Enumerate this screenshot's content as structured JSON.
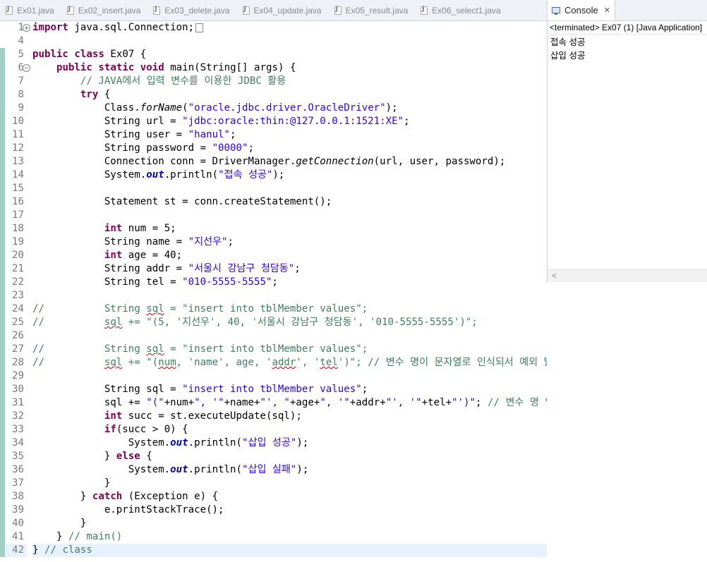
{
  "editor_tabs": [
    {
      "label": "Ex01.java"
    },
    {
      "label": "Ex02_insert.java"
    },
    {
      "label": "Ex03_delete.java"
    },
    {
      "label": "Ex04_update.java"
    },
    {
      "label": "Ex05_result.java"
    },
    {
      "label": "Ex06_select1.java"
    }
  ],
  "console": {
    "tab_label": "Console",
    "close_glyph": "✕",
    "status": "<terminated> Ex07 (1) [Java Application]",
    "output": [
      "접속 성공",
      "삽입 성공"
    ],
    "scroll_left_glyph": "<"
  },
  "code": {
    "line_numbers": [
      1,
      4,
      5,
      6,
      7,
      8,
      9,
      10,
      11,
      12,
      13,
      14,
      15,
      16,
      17,
      18,
      19,
      20,
      21,
      22,
      23,
      24,
      25,
      26,
      27,
      28,
      29,
      30,
      31,
      32,
      33,
      34,
      35,
      36,
      37,
      38,
      39,
      40,
      41,
      42
    ],
    "lines": [
      [
        {
          "t": "import",
          "c": "kw"
        },
        {
          "t": " java.sql.Connection;"
        },
        {
          "t": "",
          "c": "fbox"
        }
      ],
      [],
      [
        {
          "t": "public",
          "c": "kw"
        },
        {
          "t": " "
        },
        {
          "t": "class",
          "c": "kw"
        },
        {
          "t": " Ex07 {"
        }
      ],
      [
        {
          "t": "    "
        },
        {
          "t": "public",
          "c": "kw"
        },
        {
          "t": " "
        },
        {
          "t": "static",
          "c": "kw"
        },
        {
          "t": " "
        },
        {
          "t": "void",
          "c": "kw"
        },
        {
          "t": " main(String[] args) {"
        }
      ],
      [
        {
          "t": "        // JAVA에서 입력 변수를 이용한 JDBC 활용",
          "c": "cmt"
        }
      ],
      [
        {
          "t": "        "
        },
        {
          "t": "try",
          "c": "kw"
        },
        {
          "t": " {"
        }
      ],
      [
        {
          "t": "            Class."
        },
        {
          "t": "forName",
          "c": "sm"
        },
        {
          "t": "("
        },
        {
          "t": "\"oracle.jdbc.driver.OracleDriver\"",
          "c": "str"
        },
        {
          "t": ");"
        }
      ],
      [
        {
          "t": "            String url = "
        },
        {
          "t": "\"jdbc:oracle:thin:@127.0.0.1:1521:XE\"",
          "c": "str"
        },
        {
          "t": ";"
        }
      ],
      [
        {
          "t": "            String user = "
        },
        {
          "t": "\"hanul\"",
          "c": "str"
        },
        {
          "t": ";"
        }
      ],
      [
        {
          "t": "            String password = "
        },
        {
          "t": "\"0000\"",
          "c": "str"
        },
        {
          "t": ";"
        }
      ],
      [
        {
          "t": "            Connection conn = DriverManager."
        },
        {
          "t": "getConnection",
          "c": "sm"
        },
        {
          "t": "(url, user, password);"
        }
      ],
      [
        {
          "t": "            System."
        },
        {
          "t": "out",
          "c": "fld"
        },
        {
          "t": ".println("
        },
        {
          "t": "\"접속 성공\"",
          "c": "str"
        },
        {
          "t": ");"
        }
      ],
      [],
      [
        {
          "t": "            Statement st = conn.createStatement();"
        }
      ],
      [],
      [
        {
          "t": "            "
        },
        {
          "t": "int",
          "c": "kw"
        },
        {
          "t": " num = 5;"
        }
      ],
      [
        {
          "t": "            String name = "
        },
        {
          "t": "\"지선우\"",
          "c": "str"
        },
        {
          "t": ";"
        }
      ],
      [
        {
          "t": "            "
        },
        {
          "t": "int",
          "c": "kw"
        },
        {
          "t": " age = 40;"
        }
      ],
      [
        {
          "t": "            String addr = "
        },
        {
          "t": "\"서울시 강남구 청담동\"",
          "c": "str"
        },
        {
          "t": ";"
        }
      ],
      [
        {
          "t": "            String tel = "
        },
        {
          "t": "\"010-5555-5555\"",
          "c": "str"
        },
        {
          "t": ";"
        }
      ],
      [],
      [
        {
          "t": "//          String ",
          "c": "cmt"
        },
        {
          "t": "sql",
          "c": "cmt err"
        },
        {
          "t": " = \"insert into tblMember values\";",
          "c": "cmt"
        }
      ],
      [
        {
          "t": "//          ",
          "c": "cmt"
        },
        {
          "t": "sql",
          "c": "cmt err"
        },
        {
          "t": " += \"(5, '지선우', 40, '서울시 강남구 청담동', '010-5555-5555')\";",
          "c": "cmt"
        }
      ],
      [],
      [
        {
          "t": "//          String ",
          "c": "cmt"
        },
        {
          "t": "sql",
          "c": "cmt err"
        },
        {
          "t": " = \"insert into tblMember values\";",
          "c": "cmt"
        }
      ],
      [
        {
          "t": "//          ",
          "c": "cmt"
        },
        {
          "t": "sql",
          "c": "cmt err"
        },
        {
          "t": " += \"(",
          "c": "cmt"
        },
        {
          "t": "num",
          "c": "cmt err"
        },
        {
          "t": ", 'name', age, '",
          "c": "cmt"
        },
        {
          "t": "addr",
          "c": "cmt err"
        },
        {
          "t": "', '",
          "c": "cmt"
        },
        {
          "t": "tel",
          "c": "cmt err"
        },
        {
          "t": "')\"; // 변수 명이 문자열로 인식되서 예외 발생",
          "c": "cmt"
        }
      ],
      [],
      [
        {
          "t": "            String sql = "
        },
        {
          "t": "\"insert into tblMember values\"",
          "c": "str"
        },
        {
          "t": ";"
        }
      ],
      [
        {
          "t": "            sql += "
        },
        {
          "t": "\"(\"",
          "c": "str"
        },
        {
          "t": "+num+"
        },
        {
          "t": "\", '\"",
          "c": "str"
        },
        {
          "t": "+name+"
        },
        {
          "t": "\"', \"",
          "c": "str"
        },
        {
          "t": "+age+"
        },
        {
          "t": "\", '\"",
          "c": "str"
        },
        {
          "t": "+addr+"
        },
        {
          "t": "\"', '\"",
          "c": "str"
        },
        {
          "t": "+tel+"
        },
        {
          "t": "\"')\"",
          "c": "str"
        },
        {
          "t": "; "
        },
        {
          "t": "// 변수 명 앞에 \"+, 뒤에 +\" 적어준다.",
          "c": "cmt"
        }
      ],
      [
        {
          "t": "            "
        },
        {
          "t": "int",
          "c": "kw"
        },
        {
          "t": " succ = st.executeUpdate(sql);"
        }
      ],
      [
        {
          "t": "            "
        },
        {
          "t": "if",
          "c": "kw"
        },
        {
          "t": "(succ > 0) {"
        }
      ],
      [
        {
          "t": "                System."
        },
        {
          "t": "out",
          "c": "fld"
        },
        {
          "t": ".println("
        },
        {
          "t": "\"삽입 성공\"",
          "c": "str"
        },
        {
          "t": ");"
        }
      ],
      [
        {
          "t": "            } "
        },
        {
          "t": "else",
          "c": "kw"
        },
        {
          "t": " {"
        }
      ],
      [
        {
          "t": "                System."
        },
        {
          "t": "out",
          "c": "fld"
        },
        {
          "t": ".println("
        },
        {
          "t": "\"삽입 실패\"",
          "c": "str"
        },
        {
          "t": ");"
        }
      ],
      [
        {
          "t": "            }"
        }
      ],
      [
        {
          "t": "        } "
        },
        {
          "t": "catch",
          "c": "kw"
        },
        {
          "t": " (Exception e) {"
        }
      ],
      [
        {
          "t": "            e.printStackTrace();"
        }
      ],
      [
        {
          "t": "        }"
        }
      ],
      [
        {
          "t": "    } "
        },
        {
          "t": "// main()",
          "c": "cmt"
        }
      ],
      [
        {
          "t": "} "
        },
        {
          "t": "// class",
          "c": "cmt"
        }
      ]
    ]
  },
  "colors": {
    "keyword": "#7f0055",
    "string": "#2a00ff",
    "comment": "#3f7f5f",
    "field": "#0000c0",
    "change_ruler": "#9fd0c2",
    "current_line": "#e8f2fe"
  }
}
